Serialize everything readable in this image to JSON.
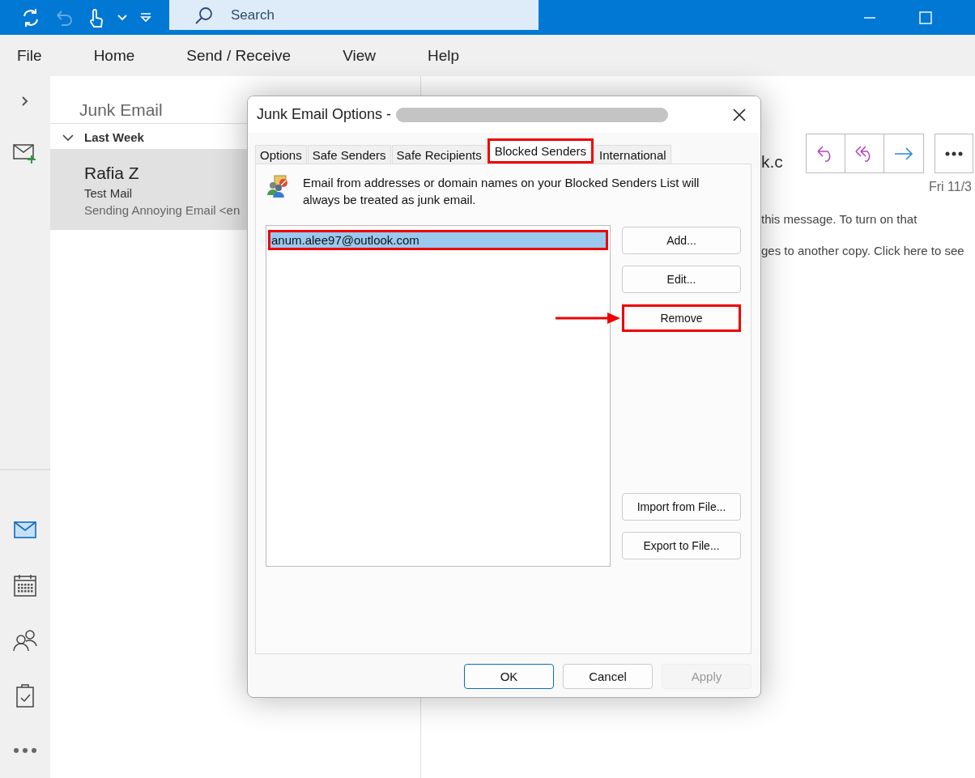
{
  "title_bar": {
    "search": {
      "placeholder": "Search"
    }
  },
  "menu": [
    "File",
    "Home",
    "Send / Receive",
    "View",
    "Help"
  ],
  "nav": [
    {
      "kind": "mail",
      "selected": true
    },
    {
      "kind": "calendar",
      "selected": false
    },
    {
      "kind": "people",
      "selected": false
    },
    {
      "kind": "tasks",
      "selected": false
    },
    {
      "kind": "more",
      "selected": false
    }
  ],
  "folder": {
    "title": "Junk Email",
    "groups": [
      {
        "label": "Last Week",
        "expanded": true,
        "messages": [
          {
            "sender": "Rafia Z",
            "subject": "Test Mail",
            "preview": "Sending Annoying Email <en",
            "selected": true
          }
        ]
      }
    ]
  },
  "reading_pane": {
    "sender_fragment": "k.c",
    "date": "Fri 11/3",
    "lines": [
      "this message. To turn on that",
      "ges to another copy. Click here to see"
    ]
  },
  "dialog": {
    "title": "Junk Email Options -",
    "title_redacted": true,
    "tabs": [
      {
        "label": "Options",
        "selected": false,
        "highlighted": false
      },
      {
        "label": "Safe Senders",
        "selected": false,
        "highlighted": false
      },
      {
        "label": "Safe Recipients",
        "selected": false,
        "highlighted": false
      },
      {
        "label": "Blocked Senders",
        "selected": true,
        "highlighted": true
      },
      {
        "label": "International",
        "selected": false,
        "highlighted": false
      }
    ],
    "description": "Email from addresses or domain names on your Blocked Senders List will always be treated as junk email.",
    "blocked_senders": [
      {
        "address": "anum.alee97@outlook.com",
        "selected": true,
        "highlighted": true
      }
    ],
    "side_buttons": [
      {
        "label": "Add...",
        "highlighted": false,
        "arrow": false
      },
      {
        "label": "Edit...",
        "highlighted": false,
        "arrow": false
      },
      {
        "label": "Remove",
        "highlighted": true,
        "arrow": true
      },
      {
        "label": "Import from File...",
        "highlighted": false,
        "arrow": false
      },
      {
        "label": "Export to File...",
        "highlighted": false,
        "arrow": false
      }
    ],
    "footer_buttons": [
      {
        "label": "OK",
        "default": true,
        "disabled": false
      },
      {
        "label": "Cancel",
        "default": false,
        "disabled": false
      },
      {
        "label": "Apply",
        "default": false,
        "disabled": true
      }
    ]
  }
}
